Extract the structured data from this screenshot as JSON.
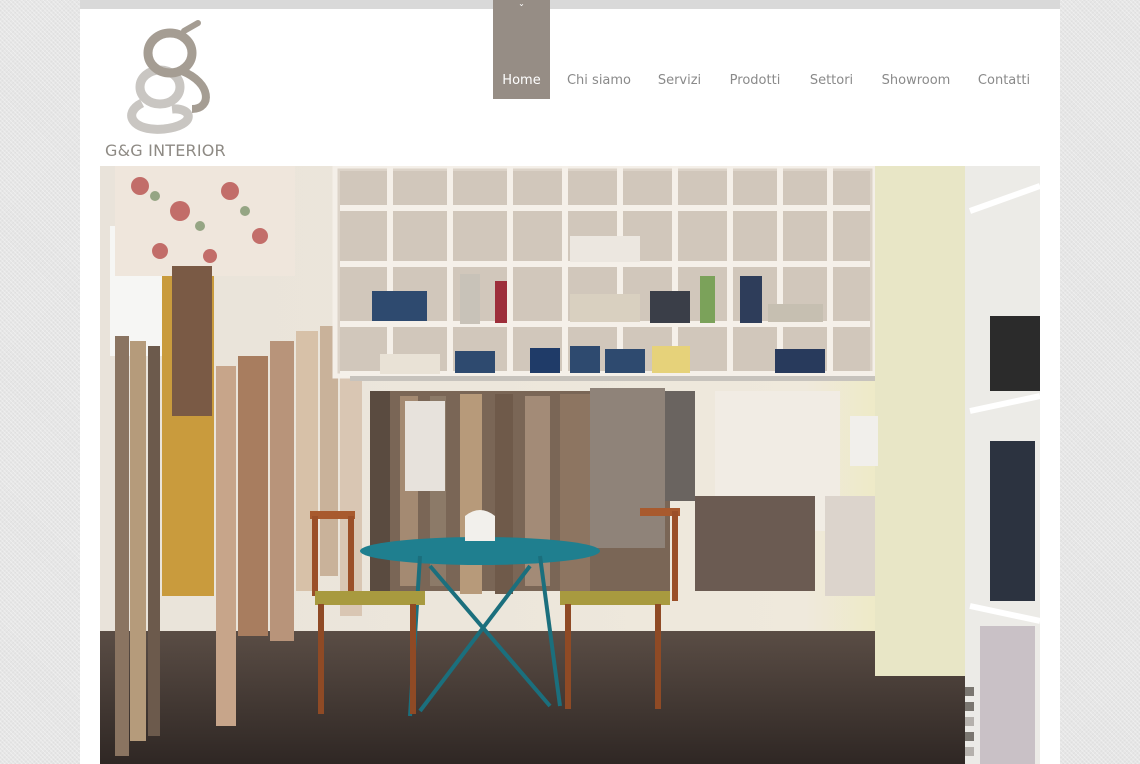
{
  "brand": {
    "name": "G&G INTERIOR",
    "logo_icon": "gg-monogram-icon",
    "colors": {
      "logo_dark": "#a59d93",
      "logo_light": "#c9c6c2"
    }
  },
  "nav": {
    "active_color": "#968d85",
    "indicator_icon": "chevron-down-icon",
    "items": [
      {
        "label": "Home",
        "active": true
      },
      {
        "label": "Chi siamo",
        "active": false
      },
      {
        "label": "Servizi",
        "active": false
      },
      {
        "label": "Prodotti",
        "active": false
      },
      {
        "label": "Settori",
        "active": false
      },
      {
        "label": "Showroom",
        "active": false
      },
      {
        "label": "Contatti",
        "active": false
      }
    ]
  },
  "hero": {
    "subject": "fabric-showroom-photo"
  },
  "slider": {
    "slides": 5,
    "current": 1
  }
}
